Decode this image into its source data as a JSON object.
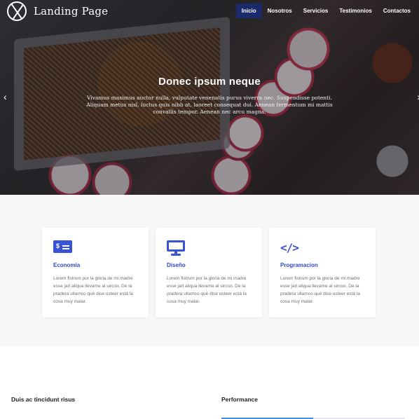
{
  "brand": {
    "name": "Landing Page",
    "logo_icon": "circle-x-logo-icon"
  },
  "nav": {
    "items": [
      {
        "label": "Inicio",
        "active": true
      },
      {
        "label": "Nosotros",
        "active": false
      },
      {
        "label": "Servicios",
        "active": false
      },
      {
        "label": "Testimonios",
        "active": false
      },
      {
        "label": "Contactos",
        "active": false
      }
    ],
    "active_color": "#1a2a6b"
  },
  "hero": {
    "title": "Donec ipsum neque",
    "text": "Vivamus maximus auctor nulla, vulputate venenatis purus viverra nec. Suspendisse potenti. Aliquam metus nisl, luctus quis nibh at, laoreet consequat dui. Aenean fermentum mi mattis convallis tempor. Aenean nec arcu magna.",
    "prev_icon": "chevron-left-icon",
    "next_icon": "chevron-right-icon"
  },
  "features": [
    {
      "icon": "money-icon",
      "icon_text": "$",
      "title": "Economia",
      "text": "Lorem fistrum por la gloria de mi madre esse jarl aliqua llevame al sircoo. De la pradera ullamco qué dise usteer está la cosa muy malar."
    },
    {
      "icon": "monitor-icon",
      "title": "Diseño",
      "text": "Lorem fistrum por la gloria de mi madre esse jarl aliqua llevame al sircoo. De la pradera ullamco qué dise usteer está la cosa muy malar."
    },
    {
      "icon": "code-icon",
      "icon_text": "</>",
      "title": "Programacion",
      "text": "Lorem fistrum por la gloria de mi madre esse jarl aliqua llevame al sircoo. De la pradera ullamco qué dise usteer está la cosa muy malar."
    }
  ],
  "accent_color": "#2f4bd0",
  "bottom": {
    "left_heading": "Duis ac tincidunt risus",
    "right_heading": "Performance",
    "performance_fraction": 0.5,
    "performance_color": "#4a90e2"
  }
}
